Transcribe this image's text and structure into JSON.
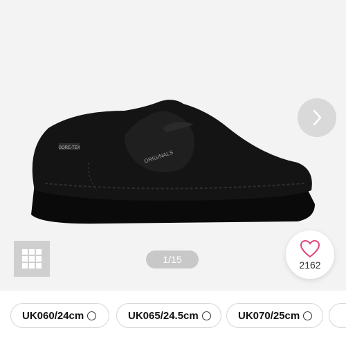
{
  "product": {
    "image_alt": "Black suede moccasin shoe",
    "tag_text": "GORE-TEX",
    "brand_text": "ORIGINALS"
  },
  "gallery": {
    "page_indicator": "1/15",
    "favorite_count": "2162"
  },
  "icons": {
    "next": "chevron-right-icon",
    "grid": "grid-icon",
    "favorite": "heart-icon"
  },
  "colors": {
    "gallery_bg": "#f3f3f3",
    "heart": "#e0457b",
    "pager_bg": "#c8c8c8"
  },
  "sizes": [
    {
      "label": "UK060/24cm"
    },
    {
      "label": "UK065/24.5cm"
    },
    {
      "label": "UK070/25cm"
    }
  ]
}
